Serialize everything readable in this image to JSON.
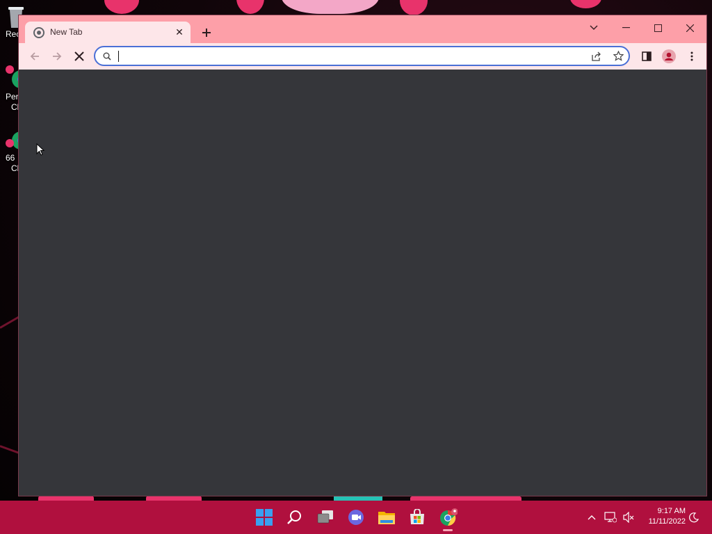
{
  "desktop": {
    "icons": [
      {
        "label": "Rec"
      },
      {
        "label_line1": "Per",
        "label_line2": "Cl"
      },
      {
        "label_line1": "66",
        "label_line2": "Cl"
      }
    ]
  },
  "browser": {
    "tabs": [
      {
        "title": "New Tab",
        "icon": "chrome-newtab-icon",
        "active": true
      }
    ],
    "omnibox": {
      "value": "",
      "placeholder": ""
    },
    "navigation": {
      "back_enabled": false,
      "forward_enabled": false,
      "loading": true
    },
    "colors": {
      "frame": "#fd9fa8",
      "toolbar": "#fde6e9",
      "content": "#35363a",
      "focus_ring": "#4a6fd6"
    }
  },
  "taskbar": {
    "apps": [
      {
        "name": "start-icon"
      },
      {
        "name": "search-icon"
      },
      {
        "name": "task-view-icon"
      },
      {
        "name": "chat-icon"
      },
      {
        "name": "file-explorer-icon"
      },
      {
        "name": "microsoft-store-icon"
      },
      {
        "name": "chrome-icon",
        "active": true
      }
    ],
    "clock": {
      "time": "9:17 AM",
      "date": "11/11/2022"
    },
    "color": "#b0103e"
  }
}
